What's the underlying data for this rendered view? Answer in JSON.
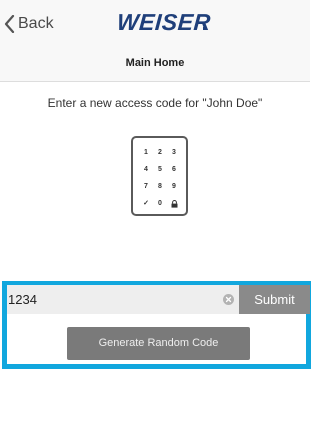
{
  "nav": {
    "back_label": "Back",
    "brand": "WEISER"
  },
  "subheader": {
    "title": "Main Home"
  },
  "prompt": {
    "text": "Enter a new access code for \"John Doe\""
  },
  "keypad": {
    "keys": [
      "1",
      "2",
      "3",
      "4",
      "5",
      "6",
      "7",
      "8",
      "9",
      "✓",
      "0",
      "lock"
    ]
  },
  "code_entry": {
    "value": "1234",
    "submit_label": "Submit"
  },
  "generate": {
    "label": "Generate Random Code"
  },
  "colors": {
    "highlight": "#11a7de",
    "brand": "#1f3f7a",
    "submit_bg": "#8a8a8a",
    "generate_bg": "#7a7a7a"
  },
  "icons": {
    "back": "chevron-left-icon",
    "clear": "clear-x-icon",
    "lock": "lock-icon",
    "check": "checkmark-icon"
  }
}
